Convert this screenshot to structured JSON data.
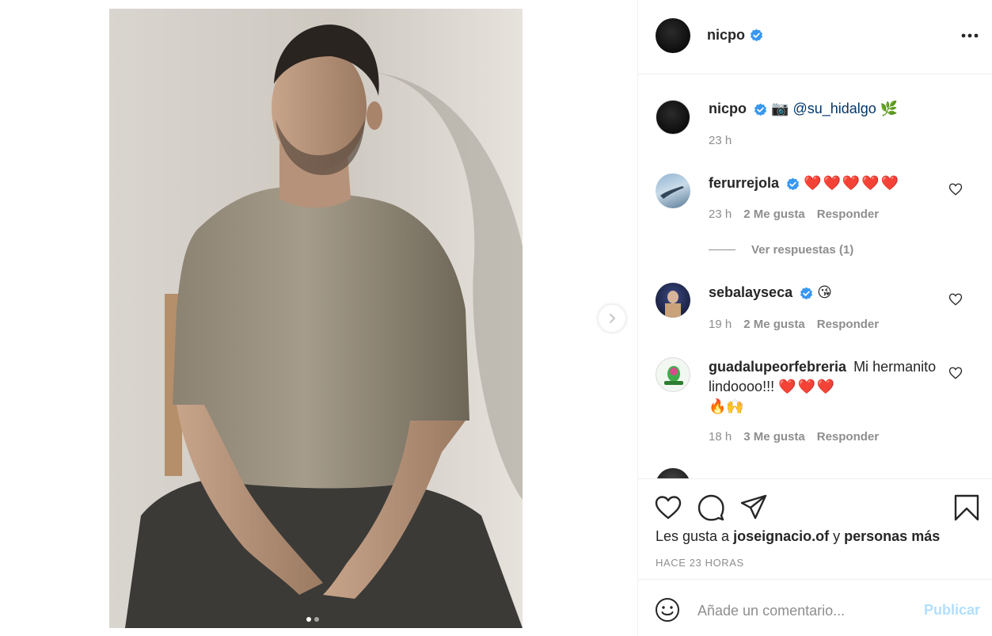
{
  "post": {
    "author": "nicpo",
    "author_verified": true,
    "carousel": {
      "slides": 2,
      "active": 1
    }
  },
  "header": {
    "username": "nicpo",
    "more_icon": "more-horizontal-icon"
  },
  "caption": {
    "username": "nicpo",
    "camera_emoji": "📷",
    "mention": "@su_hidalgo",
    "leaf_emoji": "🌿",
    "time": "23 h"
  },
  "comments": [
    {
      "username": "ferurrejola",
      "verified": true,
      "text": "❤️❤️❤️❤️❤️",
      "time": "23 h",
      "likes": "2 Me gusta",
      "reply": "Responder",
      "view_replies": "Ver respuestas (1)"
    },
    {
      "username": "sebalayseca",
      "verified": true,
      "text": "😘",
      "time": "19 h",
      "likes": "2 Me gusta",
      "reply": "Responder"
    },
    {
      "username": "guadalupeorfebreria",
      "verified": false,
      "text_part1": "Mi",
      "text_part2": "hermanito lindoooo!!!",
      "hearts": "❤️❤️❤️",
      "text_line3": "🔥🙌",
      "time": "18 h",
      "likes": "3 Me gusta",
      "reply": "Responder"
    }
  ],
  "likes": {
    "prefix": "Les gusta a",
    "user": "joseignacio.of",
    "joiner": "y",
    "others": "personas más"
  },
  "timestamp": "HACE 23 HORAS",
  "comment_box": {
    "placeholder": "Añade un comentario...",
    "publish_label": "Publicar"
  },
  "colors": {
    "verified": "#3897f0",
    "link": "#00376b",
    "muted": "#8e8e8e",
    "publish_disabled": "#b2dffc",
    "heart": "#e0163b"
  }
}
